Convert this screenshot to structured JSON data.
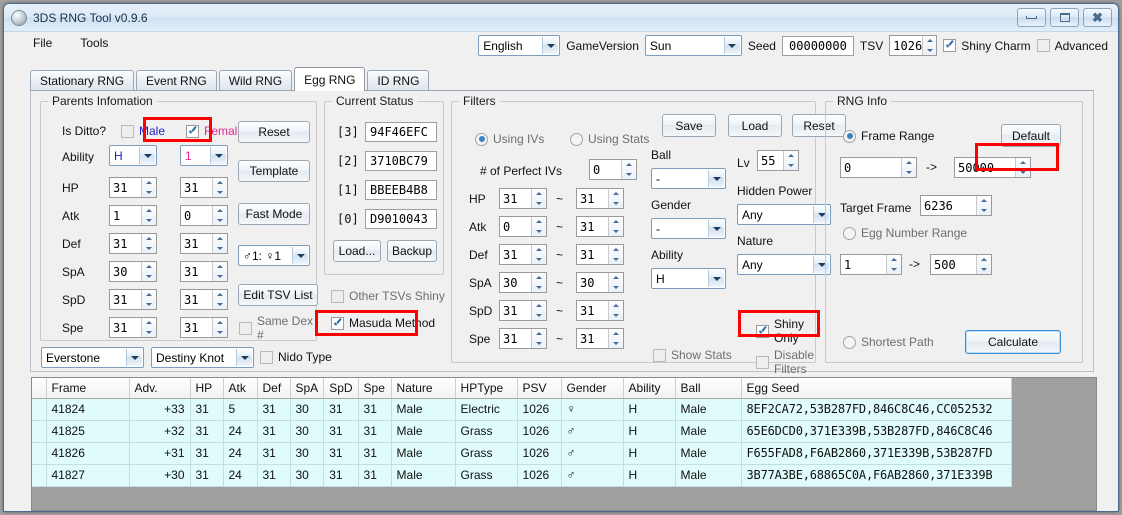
{
  "window": {
    "title": "3DS RNG Tool v0.9.6",
    "buttons": {
      "minimize": "minimize",
      "maximize": "maximize",
      "close": "close"
    }
  },
  "menu": {
    "items": [
      "File",
      "Tools"
    ]
  },
  "toolbar": {
    "language": "English",
    "game_version_label": "GameVersion",
    "game_version": "Sun",
    "seed_label": "Seed",
    "seed": "00000000",
    "tsv_label": "TSV",
    "tsv": "1026",
    "shiny_charm_label": "Shiny Charm",
    "shiny_charm_checked": true,
    "advanced_label": "Advanced",
    "advanced_checked": false
  },
  "tabs": [
    {
      "label": "Stationary RNG",
      "active": false
    },
    {
      "label": "Event RNG",
      "active": false
    },
    {
      "label": "Wild RNG",
      "active": false
    },
    {
      "label": "Egg RNG",
      "active": true
    },
    {
      "label": "ID RNG",
      "active": false
    }
  ],
  "parents": {
    "legend": "Parents Infomation",
    "is_ditto_label": "Is Ditto?",
    "male_label": "Male",
    "male_checked": false,
    "female_label": "Female",
    "female_checked": true,
    "ability_label": "Ability",
    "ability_male": "H",
    "ability_female": "1",
    "stats": [
      {
        "name": "HP",
        "male": "31",
        "female": "31"
      },
      {
        "name": "Atk",
        "male": "1",
        "female": "0"
      },
      {
        "name": "Def",
        "male": "31",
        "female": "31"
      },
      {
        "name": "SpA",
        "male": "30",
        "female": "31"
      },
      {
        "name": "SpD",
        "male": "31",
        "female": "31"
      },
      {
        "name": "Spe",
        "male": "31",
        "female": "31"
      }
    ],
    "reset_label": "Reset",
    "template_label": "Template",
    "fast_mode_label": "Fast Mode",
    "gender_ratio": "♂1: ♀1",
    "edit_tsv_label": "Edit TSV List",
    "same_dex_label": "Same Dex #",
    "same_dex_checked": false,
    "item_male": "Everstone",
    "item_female": "Destiny Knot",
    "nido_type_label": "Nido Type",
    "nido_type_checked": false
  },
  "current_status": {
    "legend": "Current Status",
    "rows": [
      {
        "index": "[3]",
        "value": "94F46EFC"
      },
      {
        "index": "[2]",
        "value": "3710BC79"
      },
      {
        "index": "[1]",
        "value": "BBEEB4B8"
      },
      {
        "index": "[0]",
        "value": "D9010043"
      }
    ],
    "load_label": "Load...",
    "backup_label": "Backup",
    "other_tsvs_label": "Other TSVs Shiny",
    "other_tsvs_checked": false,
    "masuda_label": "Masuda Method",
    "masuda_checked": true
  },
  "filters": {
    "legend": "Filters",
    "using_ivs_label": "Using IVs",
    "using_ivs_selected": true,
    "using_stats_label": "Using Stats",
    "using_stats_selected": false,
    "perfect_ivs_label": "# of Perfect IVs",
    "perfect_ivs": "0",
    "separator": "~",
    "ivs": [
      {
        "name": "HP",
        "min": "31",
        "max": "31"
      },
      {
        "name": "Atk",
        "min": "0",
        "max": "31"
      },
      {
        "name": "Def",
        "min": "31",
        "max": "31"
      },
      {
        "name": "SpA",
        "min": "30",
        "max": "30"
      },
      {
        "name": "SpD",
        "min": "31",
        "max": "31"
      },
      {
        "name": "Spe",
        "min": "31",
        "max": "31"
      }
    ],
    "save_label": "Save",
    "load_label": "Load",
    "reset_label": "Reset",
    "ball_label": "Ball",
    "ball": "-",
    "gender_label": "Gender",
    "gender": "-",
    "ability_label": "Ability",
    "ability": "H",
    "lv_label": "Lv",
    "lv": "55",
    "hidden_power_label": "Hidden Power",
    "hidden_power": "Any",
    "nature_label": "Nature",
    "nature": "Any",
    "shiny_only_label": "Shiny Only",
    "shiny_only_checked": true,
    "show_stats_label": "Show Stats",
    "show_stats_checked": false,
    "disable_filters_label": "Disable Filters",
    "disable_filters_checked": false
  },
  "rng_info": {
    "legend": "RNG Info",
    "frame_range_label": "Frame Range",
    "frame_range_selected": true,
    "default_label": "Default",
    "frame_from": "0",
    "frame_arrow": "->",
    "frame_to": "50000",
    "target_frame_label": "Target Frame",
    "target_frame": "6236",
    "egg_number_range_label": "Egg Number Range",
    "egg_number_selected": false,
    "egg_from": "1",
    "egg_arrow": "->",
    "egg_to": "500",
    "shortest_path_label": "Shortest Path",
    "shortest_path_selected": false,
    "calculate_label": "Calculate"
  },
  "results": {
    "columns": [
      "Frame",
      "Adv.",
      "HP",
      "Atk",
      "Def",
      "SpA",
      "SpD",
      "Spe",
      "Nature",
      "HPType",
      "PSV",
      "Gender",
      "Ability",
      "Ball",
      "Egg Seed"
    ],
    "rows": [
      {
        "frame": "41824",
        "adv": "+33",
        "hp": "31",
        "atk": "5",
        "def": "31",
        "spa": "30",
        "spd": "31",
        "spe": "31",
        "iv_colors": [
          "m",
          "k",
          "f",
          "m",
          "m",
          "m"
        ],
        "nature": "Male",
        "hptype": "Electric",
        "psv": "1026",
        "gender": "♀",
        "ability": "H",
        "ball": "Male",
        "egg_seed": "8EF2CA72,53B287FD,846C8C46,CC052532"
      },
      {
        "frame": "41825",
        "adv": "+32",
        "hp": "31",
        "atk": "24",
        "def": "31",
        "spa": "30",
        "spd": "31",
        "spe": "31",
        "iv_colors": [
          "f",
          "k",
          "f",
          "m",
          "m",
          "m"
        ],
        "nature": "Male",
        "hptype": "Grass",
        "psv": "1026",
        "gender": "♂",
        "ability": "H",
        "ball": "Male",
        "egg_seed": "65E6DCD0,371E339B,53B287FD,846C8C46"
      },
      {
        "frame": "41826",
        "adv": "+31",
        "hp": "31",
        "atk": "24",
        "def": "31",
        "spa": "30",
        "spd": "31",
        "spe": "31",
        "iv_colors": [
          "f",
          "k",
          "f",
          "m",
          "m",
          "m"
        ],
        "nature": "Male",
        "hptype": "Grass",
        "psv": "1026",
        "gender": "♂",
        "ability": "H",
        "ball": "Male",
        "egg_seed": "F655FAD8,F6AB2860,371E339B,53B287FD"
      },
      {
        "frame": "41827",
        "adv": "+30",
        "hp": "31",
        "atk": "24",
        "def": "31",
        "spa": "30",
        "spd": "31",
        "spe": "31",
        "iv_colors": [
          "f",
          "k",
          "f",
          "m",
          "f",
          "f"
        ],
        "nature": "Male",
        "hptype": "Grass",
        "psv": "1026",
        "gender": "♂",
        "ability": "H",
        "ball": "Male",
        "egg_seed": "3B77A3BE,68865C0A,F6AB2860,371E339B"
      }
    ]
  },
  "colors": {
    "male": "#2222cc",
    "female": "#e5258f",
    "highlight": "#ff0000",
    "row_background": "#dffbfb",
    "accent": "#3b7fc4"
  }
}
